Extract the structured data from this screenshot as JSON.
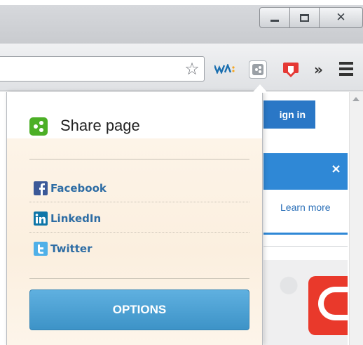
{
  "window": {
    "minimize_icon": "minimize-icon",
    "maximize_icon": "maximize-icon",
    "close_icon": "close-icon"
  },
  "toolbar": {
    "bookmark_icon": "star-icon",
    "extensions": [
      "wa-extension-icon",
      "share-extension-icon",
      "download-extension-icon"
    ],
    "overflow_glyph": "»",
    "menu_icon": "hamburger-menu-icon"
  },
  "page": {
    "signin_label": "ign in",
    "banner_close": "×",
    "learn_more": "Learn more"
  },
  "popup": {
    "title": "Share page",
    "items": [
      {
        "label": "Facebook",
        "icon": "facebook-icon",
        "color": "#3b5998"
      },
      {
        "label": "LinkedIn",
        "icon": "linkedin-icon",
        "color": "#0e76a8"
      },
      {
        "label": "Twitter",
        "icon": "twitter-icon",
        "color": "#4fb0e8"
      }
    ],
    "options_label": "OPTIONS"
  },
  "colors": {
    "brand_green": "#4caf26",
    "accent_blue": "#3d93c7",
    "link_blue": "#2e6da4",
    "cream": "#fbefdf"
  }
}
